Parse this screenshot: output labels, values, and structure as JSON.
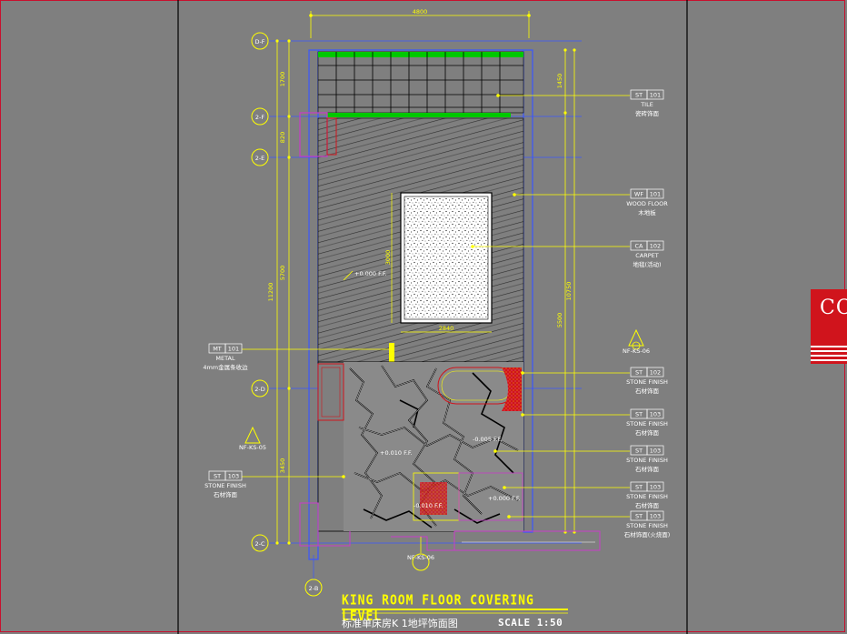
{
  "drawing": {
    "title": "KING ROOM FLOOR COVERING LEVEL",
    "subtitle": "标准单床房K 1地坪饰面图",
    "scale": "SCALE 1:50",
    "top_dimension": "4800",
    "left_dims": [
      "1700",
      "820",
      "5700",
      "3450"
    ],
    "left_total": "11200",
    "right_dims": [
      "1450",
      "5500"
    ],
    "right_total": "10750",
    "rug_width": "2840",
    "rug_height": "3000",
    "grid_axes": [
      "D-F",
      "2-F",
      "2-E",
      "2-D",
      "2-C",
      "2-B"
    ],
    "section_marker": "NF-KS-06",
    "section_marker_left": "NF-KS-05",
    "section_marker_bottom": "NF-KS-06",
    "level_marks": [
      "+0.000 F.F.",
      "+0.010 F.F.",
      "-0.005 F.F.",
      "-0.010 F.F.",
      "+0.000 F.F."
    ]
  },
  "tags": [
    {
      "code": "ST",
      "num": "101",
      "name": "TILE",
      "name_cn": "瓷砖饰面"
    },
    {
      "code": "WF",
      "num": "101",
      "name": "WOOD FLOOR",
      "name_cn": "木地板"
    },
    {
      "code": "CA",
      "num": "102",
      "name": "CARPET",
      "name_cn": "地毯(活动)"
    },
    {
      "code": "ST",
      "num": "102",
      "name": "STONE FINISH",
      "name_cn": "石材饰面"
    },
    {
      "code": "ST",
      "num": "103",
      "name": "STONE FINISH",
      "name_cn": "石材饰面"
    },
    {
      "code": "ST",
      "num": "103",
      "name": "STONE FINISH",
      "name_cn": "石材饰面"
    },
    {
      "code": "ST",
      "num": "103",
      "name": "STONE FINISH",
      "name_cn": "石材饰面"
    },
    {
      "code": "ST",
      "num": "103",
      "name": "STONE FINISH",
      "name_cn": "石材饰面(火烧面)"
    }
  ],
  "tags_left": [
    {
      "code": "MT",
      "num": "101",
      "name": "METAL",
      "name_cn": "4mm金属条收边"
    },
    {
      "code": "ST",
      "num": "103",
      "name": "STONE FINISH",
      "name_cn": "石材饰面"
    }
  ],
  "logo": {
    "text": "CO"
  },
  "colors": {
    "background": "#7f7f7f",
    "annotation": "#ffff00",
    "wall_blue": "#3a57ff",
    "accent_red": "#d0141c",
    "tile_green": "#00c800",
    "hatch": "#333333"
  }
}
